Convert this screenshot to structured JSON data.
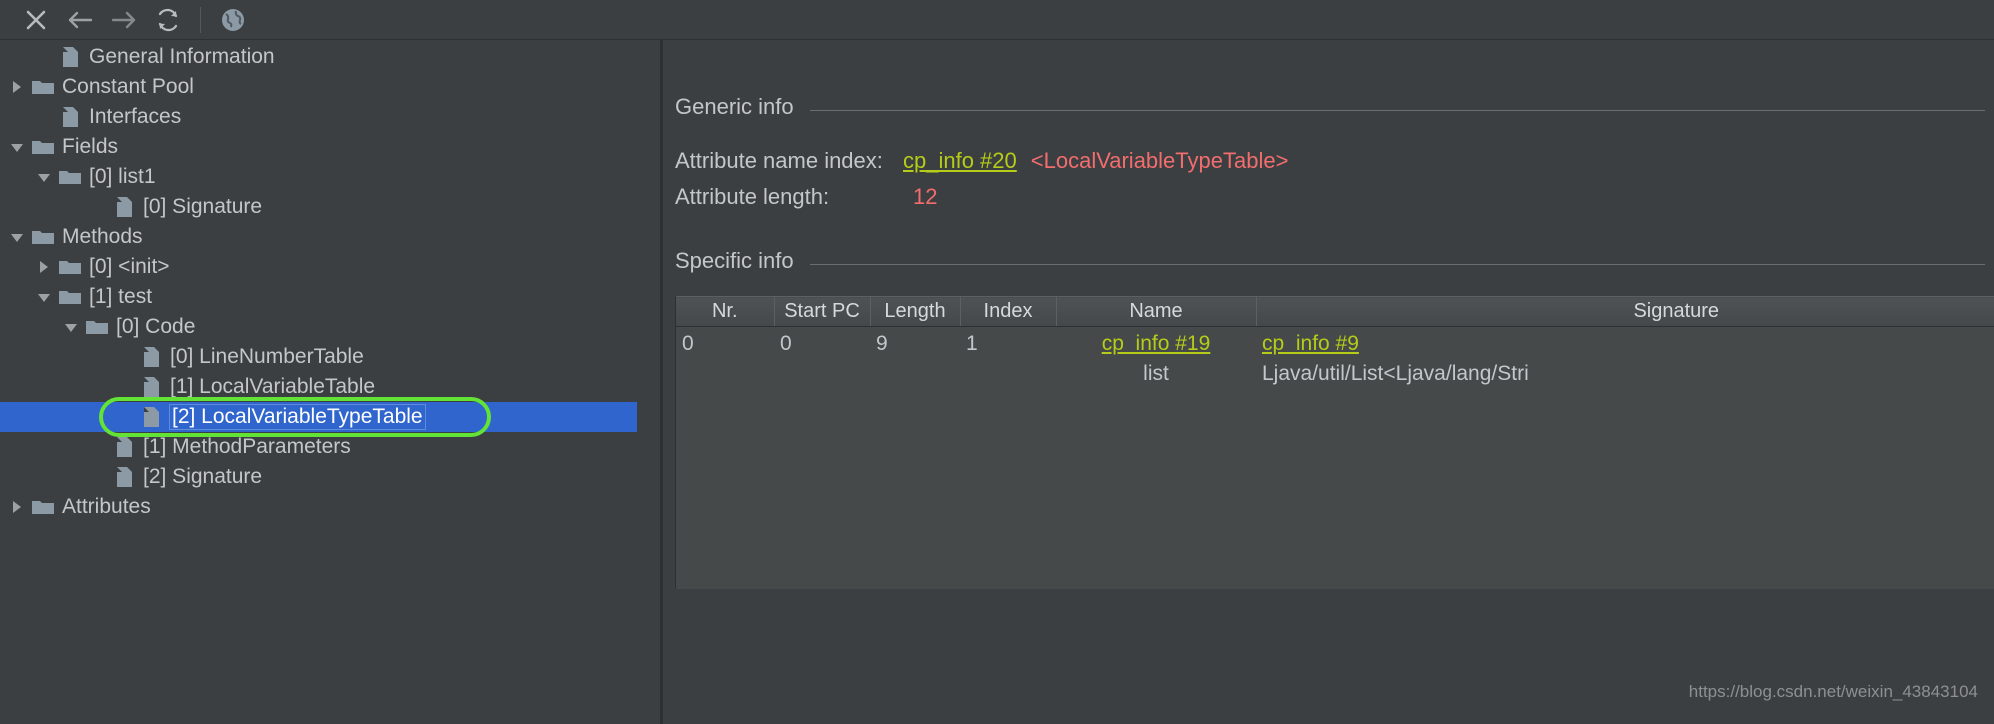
{
  "toolbar": {
    "buttons": [
      {
        "name": "close-icon",
        "label": "Close"
      },
      {
        "name": "back-arrow-icon",
        "label": "Back"
      },
      {
        "name": "forward-arrow-icon",
        "label": "Forward"
      },
      {
        "name": "reload-icon",
        "label": "Reload"
      },
      {
        "name": "globe-icon",
        "label": "Browse"
      }
    ]
  },
  "tree": {
    "items": [
      {
        "label": "General Information",
        "indent": 1,
        "twisty": "none",
        "icon": "file-icon",
        "selected": false
      },
      {
        "label": "Constant Pool",
        "indent": 0,
        "twisty": "collapsed",
        "icon": "folder-icon",
        "selected": false
      },
      {
        "label": "Interfaces",
        "indent": 1,
        "twisty": "none",
        "icon": "file-icon",
        "selected": false
      },
      {
        "label": "Fields",
        "indent": 0,
        "twisty": "expanded",
        "icon": "folder-icon",
        "selected": false
      },
      {
        "label": "[0] list1",
        "indent": 1,
        "twisty": "expanded",
        "icon": "folder-icon",
        "selected": false
      },
      {
        "label": "[0] Signature",
        "indent": 3,
        "twisty": "none",
        "icon": "file-icon",
        "selected": false
      },
      {
        "label": "Methods",
        "indent": 0,
        "twisty": "expanded",
        "icon": "folder-icon",
        "selected": false
      },
      {
        "label": "[0] <init>",
        "indent": 1,
        "twisty": "collapsed",
        "icon": "folder-icon",
        "selected": false
      },
      {
        "label": "[1] test",
        "indent": 1,
        "twisty": "expanded",
        "icon": "folder-icon",
        "selected": false
      },
      {
        "label": "[0] Code",
        "indent": 2,
        "twisty": "expanded",
        "icon": "folder-icon",
        "selected": false
      },
      {
        "label": "[0] LineNumberTable",
        "indent": 4,
        "twisty": "none",
        "icon": "file-icon",
        "selected": false
      },
      {
        "label": "[1] LocalVariableTable",
        "indent": 4,
        "twisty": "none",
        "icon": "file-icon",
        "selected": false
      },
      {
        "label": "[2] LocalVariableTypeTable",
        "indent": 4,
        "twisty": "none",
        "icon": "file-icon",
        "selected": true
      },
      {
        "label": "[1] MethodParameters",
        "indent": 3,
        "twisty": "none",
        "icon": "file-icon",
        "selected": false
      },
      {
        "label": "[2] Signature",
        "indent": 3,
        "twisty": "none",
        "icon": "file-icon",
        "selected": false
      },
      {
        "label": "Attributes",
        "indent": 0,
        "twisty": "collapsed",
        "icon": "folder-icon",
        "selected": false
      }
    ]
  },
  "detail": {
    "generic_info": {
      "heading": "Generic info",
      "attribute_name_index_label": "Attribute name index:",
      "attribute_name_index_link": "cp_info #20",
      "attribute_name_index_value": "<LocalVariableTypeTable>",
      "attribute_length_label": "Attribute length:",
      "attribute_length_value": "12"
    },
    "specific_info": {
      "heading": "Specific info",
      "table": {
        "columns": [
          "Nr.",
          "Start PC",
          "Length",
          "Index",
          "Name",
          "Signature"
        ],
        "rows": [
          {
            "nr": "0",
            "start_pc": "0",
            "length": "9",
            "index": "1",
            "name_link": "cp_info #19",
            "name_value": "list",
            "signature_link": "cp_info #9",
            "signature_value": "Ljava/util/List<Ljava/lang/Stri"
          }
        ]
      }
    }
  },
  "watermark": {
    "text": "https://blog.csdn.net/weixin_43843104"
  },
  "colors": {
    "background": "#3c3f41",
    "selection": "#2f65cc",
    "link": "#b5cc18",
    "value_red": "#f26d6d",
    "annotation_green": "#62e336",
    "table_background": "#45494a"
  }
}
